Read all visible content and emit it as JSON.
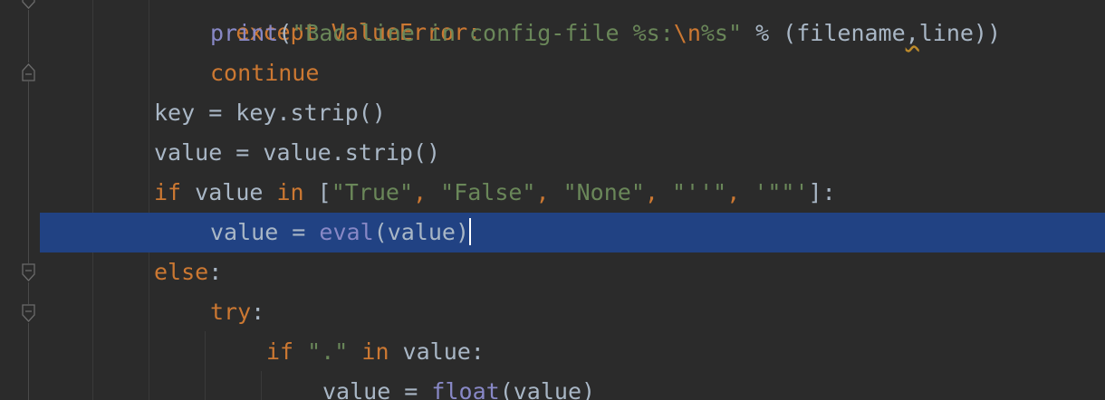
{
  "editor": {
    "language": "python",
    "current_line_color": "#214283",
    "colors": {
      "background": "#2b2b2b",
      "keyword": "#cc7832",
      "string": "#6a8759",
      "builtin": "#8888c6",
      "plain": "#a9b7c6"
    },
    "lines": [
      {
        "t": [
          "except ValueError:"
        ]
      },
      {
        "t": [
          "print",
          "(",
          "\"Bad line in config-file %s:",
          "\\n",
          "%s\"",
          " % (filename",
          ",",
          "line))"
        ]
      },
      {
        "t": [
          "continue"
        ]
      },
      {
        "t": [
          "key = key.strip()"
        ]
      },
      {
        "t": [
          "value = value.strip()"
        ]
      },
      {
        "t": [
          "if",
          " value ",
          "in",
          " [",
          "\"True\"",
          ", ",
          "\"False\"",
          ", ",
          "\"None\"",
          ", ",
          "\"''\"",
          ", ",
          "'\"\"'",
          "]:"
        ]
      },
      {
        "t": [
          "value = ",
          "eval",
          "(value)"
        ]
      },
      {
        "t": [
          "else",
          ":"
        ]
      },
      {
        "t": [
          "try",
          ":"
        ]
      },
      {
        "t": [
          "if",
          " ",
          "\".\"",
          " ",
          "in",
          " value:"
        ]
      },
      {
        "t": [
          "value = ",
          "float",
          "(value)"
        ]
      }
    ]
  }
}
